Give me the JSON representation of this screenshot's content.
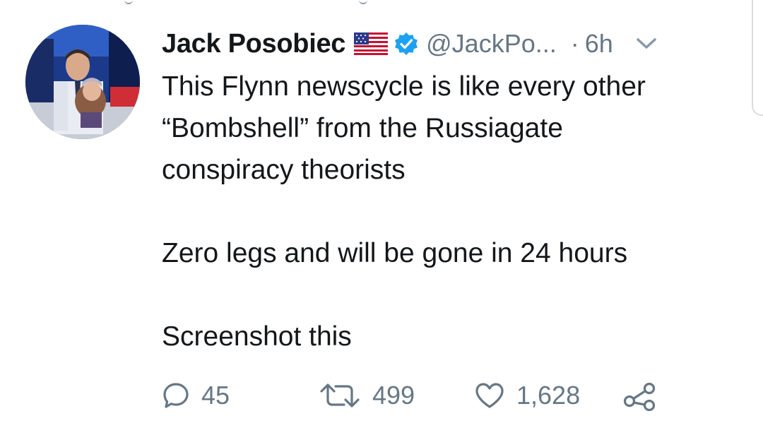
{
  "tweet": {
    "display_name": "Jack Posobiec",
    "handle": "@JackPo...",
    "separator": "·",
    "time": "6h",
    "text_lines": [
      "This Flynn newscycle is like every other",
      "“Bombshell” from the Russiagate",
      "conspiracy theorists"
    ],
    "paragraph_2": "Zero legs and will be gone in 24 hours",
    "paragraph_3": "Screenshot this"
  },
  "actions": {
    "replies": "45",
    "retweets": "499",
    "likes": "1,628"
  },
  "colors": {
    "text": "#14171a",
    "secondary": "#657786",
    "verified": "#1da1f2"
  },
  "icons": [
    "us-flag-icon",
    "verified-badge-icon",
    "chevron-down-icon",
    "reply-icon",
    "retweet-icon",
    "like-icon",
    "share-icon"
  ]
}
